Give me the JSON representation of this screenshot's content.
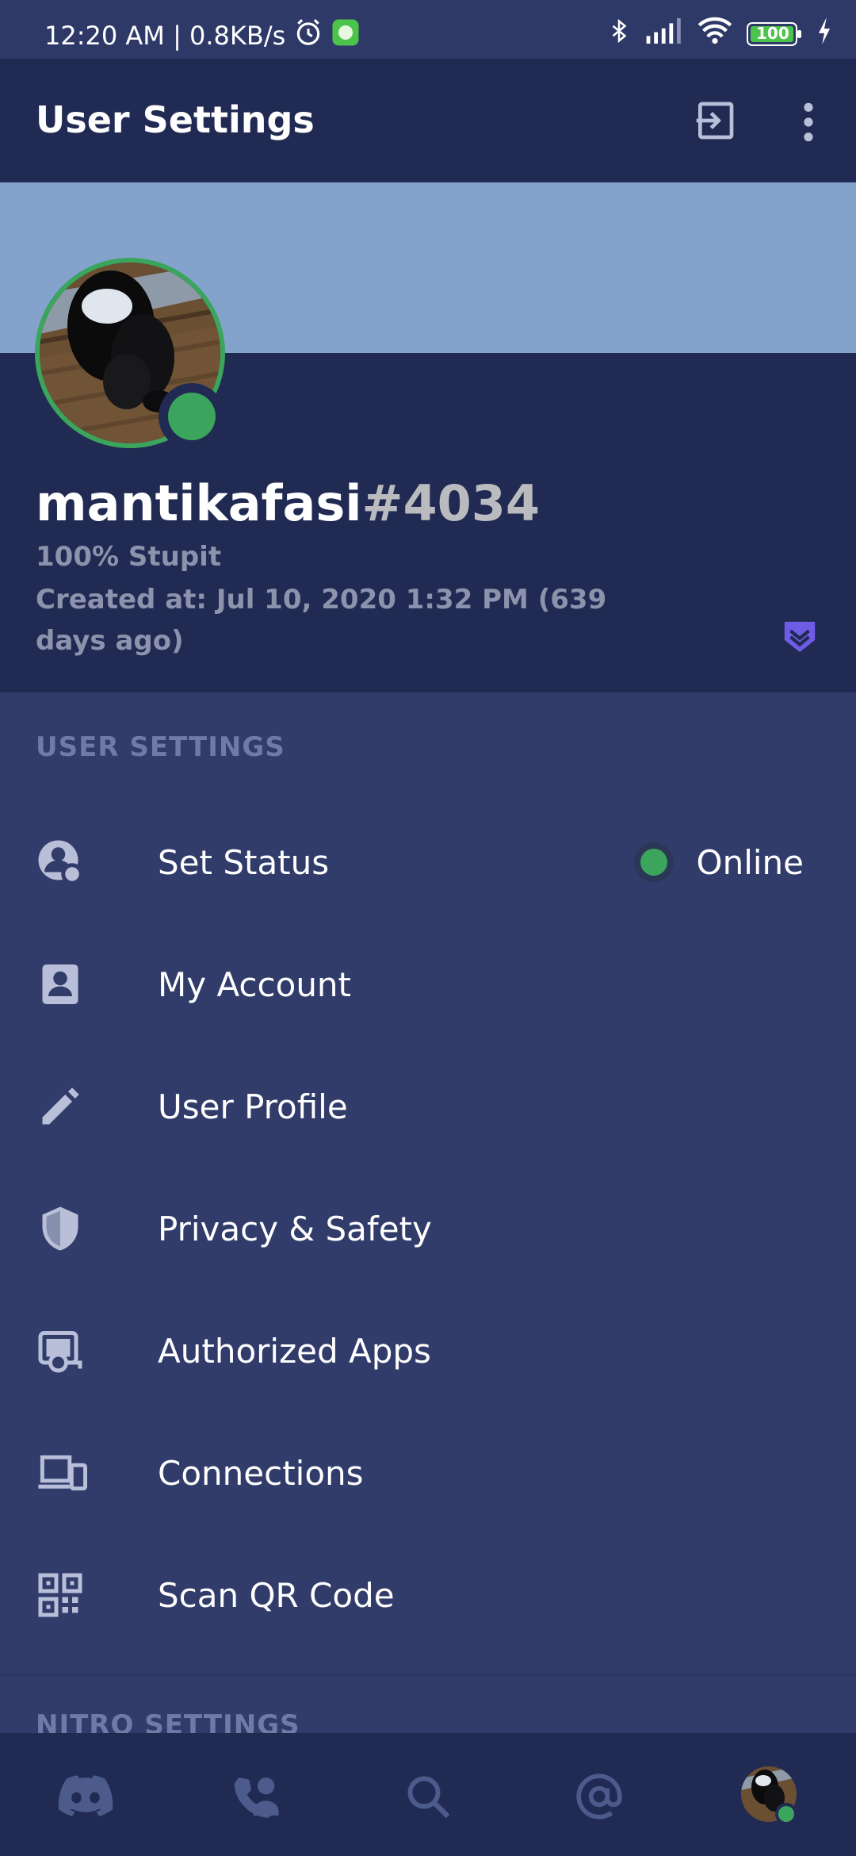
{
  "status_bar": {
    "time_speed": "12:20 AM | 0.8KB/s",
    "battery": "100",
    "icons": [
      "alarm-icon",
      "app-notification-icon",
      "bluetooth-icon",
      "signal-icon",
      "wifi-icon",
      "battery-icon",
      "charging-icon"
    ]
  },
  "app_bar": {
    "title": "User Settings",
    "icons": [
      "logout-icon",
      "more-vert-icon"
    ]
  },
  "profile": {
    "username": "mantikafasi",
    "discriminator": "#4034",
    "about": "100% Stupit",
    "created": "Created at: Jul 10, 2020 1:32 PM (639 days ago)",
    "status_color": "#3ba55d",
    "banner_color": "#84a3cc"
  },
  "user_settings": {
    "header": "USER SETTINGS",
    "items": [
      {
        "label": "Set Status",
        "icon": "status-icon",
        "value": "Online"
      },
      {
        "label": "My Account",
        "icon": "account-icon"
      },
      {
        "label": "User Profile",
        "icon": "pencil-icon"
      },
      {
        "label": "Privacy & Safety",
        "icon": "shield-icon"
      },
      {
        "label": "Authorized Apps",
        "icon": "authorized-apps-icon"
      },
      {
        "label": "Connections",
        "icon": "devices-icon"
      },
      {
        "label": "Scan QR Code",
        "icon": "qr-code-icon"
      }
    ]
  },
  "nitro_settings": {
    "header": "NITRO SETTINGS"
  },
  "bottom_nav": {
    "items": [
      "discord-home-icon",
      "friends-icon",
      "search-icon",
      "mentions-icon",
      "profile-avatar"
    ]
  },
  "colors": {
    "accent": "#5865f2",
    "online": "#3ba55d",
    "background": "#313c6b",
    "panel": "#212a53"
  }
}
